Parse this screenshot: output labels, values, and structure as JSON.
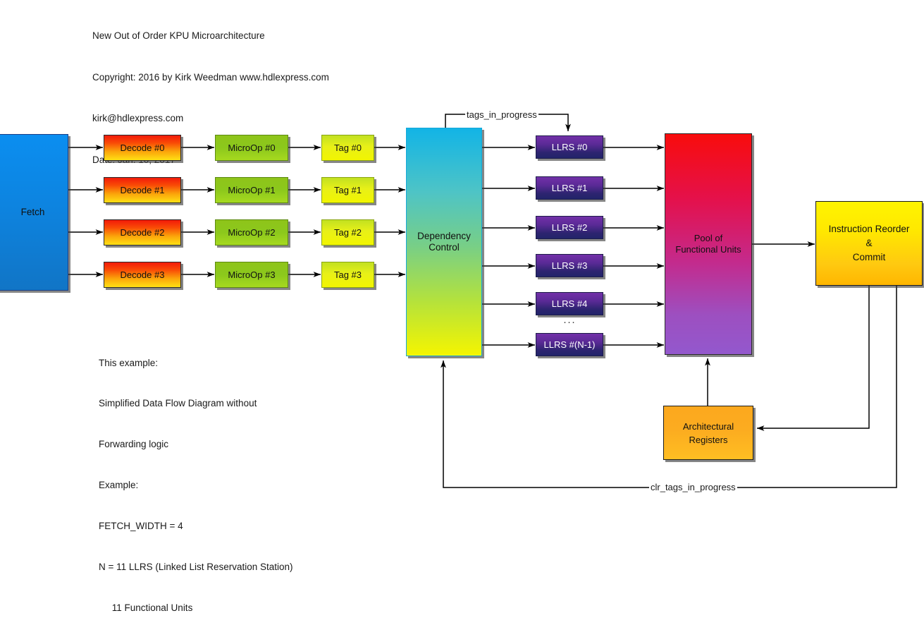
{
  "header": {
    "line1": "New Out of Order KPU Microarchitecture",
    "line2": "Copyright: 2016 by Kirk Weedman www.hdlexpress.com",
    "line3": "kirk@hdlexpress.com",
    "line4": "Date: Jan. 10, 2017"
  },
  "notes": {
    "line1": "This example:",
    "line2": "Simplified Data Flow Diagram without",
    "line3": "Forwarding logic",
    "line4": "Example:",
    "line5": "FETCH_WIDTH = 4",
    "line6": "N = 11 LLRS (Linked List Reservation Station)",
    "line7": "     11 Functional Units"
  },
  "blocks": {
    "fetch": "Fetch",
    "decode": [
      "Decode #0",
      "Decode #1",
      "Decode #2",
      "Decode #3"
    ],
    "microop": [
      "MicroOp #0",
      "MicroOp #1",
      "MicroOp #2",
      "MicroOp #3"
    ],
    "tag": [
      "Tag #0",
      "Tag #1",
      "Tag #2",
      "Tag #3"
    ],
    "dependency_control": "Dependency\nControl",
    "llrs": [
      "LLRS #0",
      "LLRS #1",
      "LLRS #2",
      "LLRS #3",
      "LLRS #4",
      "LLRS #(N-1)"
    ],
    "llrs_ellipsis": "···",
    "pool": "Pool of\nFunctional Units",
    "reorder_commit": "Instruction Reorder\n&\nCommit",
    "architectural_registers": "Architectural\nRegisters"
  },
  "wire_labels": {
    "tags_in_progress": "tags_in_progress",
    "clr_tags_in_progress": "clr_tags_in_progress"
  },
  "colors": {
    "fetch": "#0d84e0",
    "decode_top": "#f21a0a",
    "decode_bottom": "#ffe014",
    "microop": "#8cc81c",
    "tag": "#f2f500",
    "dependency_top": "#12b4e6",
    "dependency_bottom": "#f5f500",
    "llrs_top": "#7230a8",
    "llrs_bottom": "#22246a",
    "pool_top": "#f80c0c",
    "pool_bottom": "#9358cd",
    "reorder": "#ffe800",
    "arch_registers": "#fcac20",
    "wire": "#000000",
    "background": "#ffffff"
  }
}
